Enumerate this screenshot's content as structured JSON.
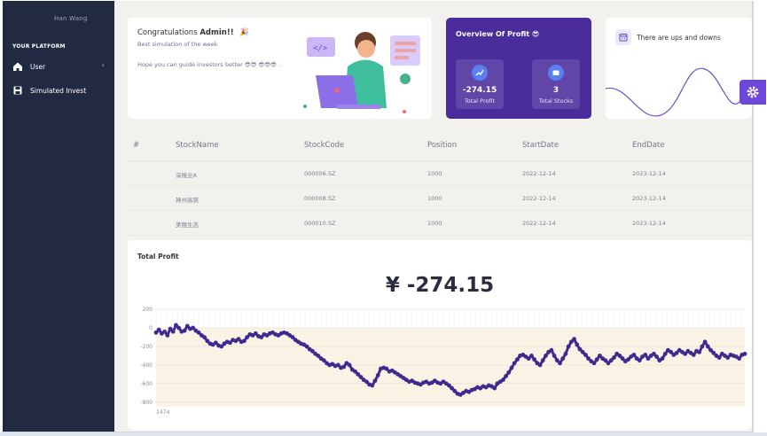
{
  "sidebar": {
    "user_name": "Han Wang",
    "section_label": "YOUR PLATFORM",
    "items": [
      {
        "label": "User",
        "icon": "home-icon",
        "has_children": true
      },
      {
        "label": "Simulated Invest",
        "icon": "save-icon",
        "has_children": false
      }
    ]
  },
  "congrats": {
    "title_prefix": "Congratulations ",
    "title_bold": "Admin!!",
    "title_emoji": "🎉",
    "subtitle": "Best simulation of the week",
    "message": "Hope you can guide investors better 😎😎 😎😎😎 ."
  },
  "overview": {
    "title": "Overview Of Profit 😎",
    "total_profit_value": "-274.15",
    "total_profit_label": "Total Profit",
    "total_stocks_value": "3",
    "total_stocks_label": "Total Stocks"
  },
  "ups_card": {
    "title": "There are ups and downs"
  },
  "table": {
    "headers": [
      "#",
      "StockName",
      "StockCode",
      "Position",
      "StartDate",
      "EndDate"
    ],
    "rows": [
      [
        "",
        "深振业A",
        "000006.SZ",
        "1000",
        "2022-12-14",
        "2023-12-14"
      ],
      [
        "",
        "神州高铁",
        "000008.SZ",
        "1000",
        "2022-12-14",
        "2023-12-14"
      ],
      [
        "",
        "美丽生态",
        "000010.SZ",
        "1000",
        "2022-12-14",
        "2023-12-14"
      ]
    ]
  },
  "profit": {
    "title": "Total Profit",
    "big_value": "¥ -274.15"
  },
  "colors": {
    "sidebar": "#222a42",
    "accent": "#4a2d9a",
    "line": "#3f2a8f",
    "negative_band": "#fbf3e4"
  },
  "chart_data": {
    "type": "line",
    "title": "",
    "xlabel": "",
    "ylabel": "",
    "x_tick_labels": [
      "1474"
    ],
    "y_ticks": [
      200,
      0,
      -200,
      -400,
      -600,
      -800
    ],
    "ylim": [
      -850,
      220
    ],
    "series": [
      {
        "values": [
          -50,
          -20,
          -60,
          -40,
          -80,
          -10,
          -40,
          30,
          0,
          -40,
          -30,
          20,
          -10,
          0,
          -30,
          -50,
          -80,
          -100,
          -140,
          -170,
          -180,
          -160,
          -190,
          -200,
          -170,
          -150,
          -160,
          -130,
          -140,
          -120,
          -150,
          -140,
          -100,
          -70,
          -80,
          -60,
          -90,
          -100,
          -70,
          -80,
          -60,
          -50,
          -70,
          -80,
          -60,
          -50,
          -60,
          -80,
          -100,
          -130,
          -150,
          -170,
          -180,
          -200,
          -230,
          -250,
          -280,
          -300,
          -330,
          -350,
          -380,
          -400,
          -390,
          -410,
          -400,
          -430,
          -420,
          -380,
          -400,
          -450,
          -470,
          -500,
          -530,
          -560,
          -580,
          -610,
          -620,
          -570,
          -510,
          -440,
          -430,
          -440,
          -470,
          -460,
          -480,
          -500,
          -520,
          -540,
          -560,
          -580,
          -570,
          -590,
          -600,
          -610,
          -590,
          -580,
          -600,
          -590,
          -570,
          -590,
          -600,
          -580,
          -600,
          -620,
          -650,
          -680,
          -710,
          -720,
          -700,
          -680,
          -690,
          -670,
          -660,
          -640,
          -650,
          -630,
          -640,
          -620,
          -630,
          -650,
          -600,
          -580,
          -560,
          -520,
          -480,
          -430,
          -380,
          -340,
          -300,
          -290,
          -310,
          -330,
          -300,
          -340,
          -380,
          -400,
          -350,
          -300,
          -260,
          -240,
          -300,
          -350,
          -380,
          -330,
          -280,
          -200,
          -150,
          -120,
          -180,
          -230,
          -260,
          -290,
          -330,
          -360,
          -380,
          -340,
          -300,
          -330,
          -350,
          -380,
          -350,
          -320,
          -280,
          -300,
          -330,
          -360,
          -340,
          -310,
          -290,
          -330,
          -350,
          -310,
          -290,
          -330,
          -300,
          -280,
          -310,
          -350,
          -330,
          -280,
          -240,
          -260,
          -290,
          -270,
          -240,
          -260,
          -280,
          -250,
          -270,
          -290,
          -250,
          -260,
          -200,
          -150,
          -200,
          -240,
          -270,
          -300,
          -320,
          -280,
          -300,
          -320,
          -290,
          -300,
          -310,
          -330,
          -290,
          -280
        ]
      }
    ]
  }
}
